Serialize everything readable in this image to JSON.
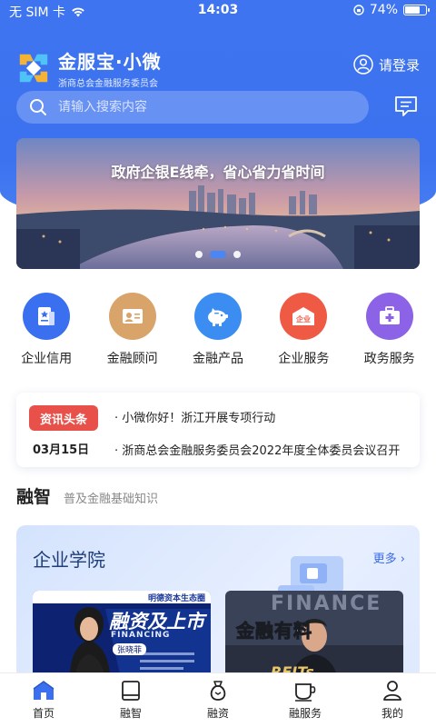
{
  "status_bar": {
    "carrier": "无 SIM 卡",
    "time": "14:03",
    "battery": "74%",
    "battery_level": 0.74
  },
  "header": {
    "brand_title": "金服宝·小微",
    "brand_subtitle": "浙商总会金融服务委员会",
    "login_label": "请登录"
  },
  "search": {
    "placeholder": "请输入搜索内容"
  },
  "banner": {
    "caption": "政府企银E线牵，省心省力省时间",
    "slide_count": 3,
    "active_slide": 2
  },
  "quick_menu": [
    {
      "label": "企业信用",
      "icon": "credit-icon",
      "color": "#3a6ff0"
    },
    {
      "label": "金融顾问",
      "icon": "advisor-icon",
      "color": "#d9a46a"
    },
    {
      "label": "金融产品",
      "icon": "piggy-bank-icon",
      "color": "#3b8df2"
    },
    {
      "label": "企业服务",
      "icon": "enterprise-icon",
      "color": "#ef5a45",
      "badge": "企业"
    },
    {
      "label": "政务服务",
      "icon": "briefcase-icon",
      "color": "#8c62e6"
    }
  ],
  "news": {
    "tag": "资讯头条",
    "date": "03月15日",
    "items": [
      "小微你好！浙江开展专项行动",
      "浙商总会金融服务委员会2022年度全体委员会议召开"
    ]
  },
  "section": {
    "title": "融智",
    "subtitle": "普及金融基础知识"
  },
  "academy": {
    "title": "企业学院",
    "more_label": "更多",
    "courses": [
      {
        "top_badge": "明德资本生态圈",
        "headline": "融资及上市",
        "en_headline": "FINANCING",
        "speaker_tag": "张晓菲"
      },
      {
        "headline": "金融有料",
        "bg_text": "FINANCE",
        "bg_text_2": "REITs"
      }
    ]
  },
  "tabbar": [
    {
      "label": "首页",
      "icon": "home-icon",
      "active": true
    },
    {
      "label": "融智",
      "icon": "book-icon",
      "active": false
    },
    {
      "label": "融资",
      "icon": "money-bag-icon",
      "active": false
    },
    {
      "label": "融服务",
      "icon": "cup-icon",
      "active": false
    },
    {
      "label": "我的",
      "icon": "user-icon",
      "active": false
    }
  ],
  "colors": {
    "primary": "#3c72ef",
    "tag_red": "#e8514a",
    "active_tab": "#3a6ff0"
  }
}
